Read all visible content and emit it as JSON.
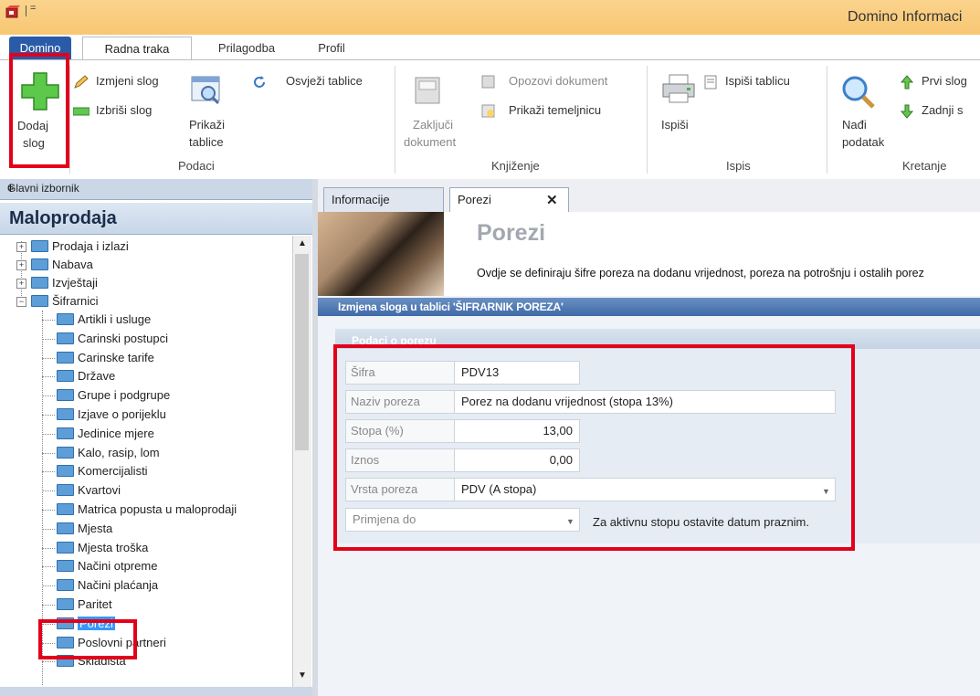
{
  "window": {
    "title": "Domino Informaci"
  },
  "qat": {
    "arrow": "="
  },
  "ribbon_tabs": [
    "Domino",
    "Radna traka",
    "Prilagodba",
    "Profil"
  ],
  "ribbon": {
    "dodaj": [
      "Dodaj",
      "slog"
    ],
    "izmijeni": "Izmjeni slog",
    "izbrisi": "Izbriši slog",
    "prikazi": [
      "Prikaži",
      "tablice"
    ],
    "osvjezi": "Osvježi tablice",
    "zakljuci": [
      "Zaključi",
      "dokument"
    ],
    "opozovi": "Opozovi dokument",
    "temeljnica": "Prikaži temeljnicu",
    "ispisi_tablicu": "Ispiši tablicu",
    "ispisi": "Ispiši",
    "nadi": [
      "Nađi",
      "podatak"
    ],
    "prvi": "Prvi slog",
    "zadnji": "Zadnji s",
    "groups": [
      "Podaci",
      "Knjiženje",
      "Ispis",
      "Kretanje"
    ]
  },
  "left_panel": {
    "header": "Glavni izbornik",
    "pin": "ǂ",
    "title": "Maloprodaja",
    "top_items": [
      "Prodaja i izlazi",
      "Nabava",
      "Izvještaji",
      "Šifrarnici"
    ],
    "sub_items": [
      "Artikli i usluge",
      "Carinski postupci",
      "Carinske tarife",
      "Države",
      "Grupe i podgrupe",
      "Izjave o porijeklu",
      "Jedinice mjere",
      "Kalo, rasip, lom",
      "Komercijalisti",
      "Kvartovi",
      "Matrica popusta u maloprodaji",
      "Mjesta",
      "Mjesta troška",
      "Načini otpreme",
      "Načini plaćanja",
      "Paritet",
      "Porezi",
      "Poslovni partneri",
      "Skladišta"
    ],
    "selected": "Porezi"
  },
  "doc_tabs": [
    "Informacije",
    "Porezi"
  ],
  "banner": {
    "title": "Porezi",
    "description": "Ovdje se definiraju šifre poreza na dodanu vrijednost, poreza na potrošnju i ostalih porez"
  },
  "edit_header": "Izmjena sloga u tablici 'ŠIFRARNIK POREZA'",
  "group_title": "Podaci o porezu",
  "fields": {
    "sifra": {
      "label": "Šifra",
      "value": "PDV13"
    },
    "naziv": {
      "label": "Naziv poreza",
      "value": "Porez na dodanu vrijednost (stopa 13%)"
    },
    "stopa": {
      "label": "Stopa (%)",
      "value": "13,00"
    },
    "iznos": {
      "label": "Iznos",
      "value": "0,00"
    },
    "vrsta": {
      "label": "Vrsta poreza",
      "value": "PDV (A stopa)"
    },
    "primjena": {
      "label": "Primjena do",
      "value": ""
    }
  },
  "note": "Za aktivnu stopu ostavite datum praznim.",
  "colors": {
    "ribbon_active_tab": "#2a5ba8",
    "highlight": "#e3001b",
    "title_bar": "#f7c773",
    "selection": "#3399ff"
  }
}
